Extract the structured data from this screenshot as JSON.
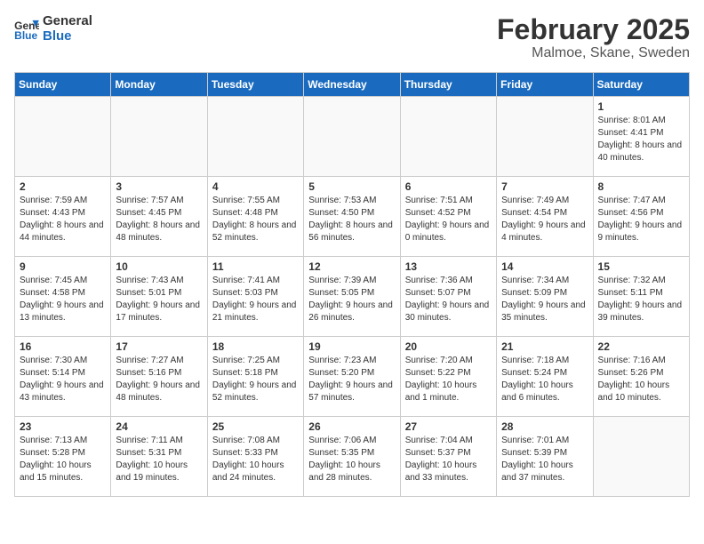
{
  "logo": {
    "general": "General",
    "blue": "Blue"
  },
  "header": {
    "title": "February 2025",
    "subtitle": "Malmoe, Skane, Sweden"
  },
  "weekdays": [
    "Sunday",
    "Monday",
    "Tuesday",
    "Wednesday",
    "Thursday",
    "Friday",
    "Saturday"
  ],
  "weeks": [
    [
      {
        "day": "",
        "info": ""
      },
      {
        "day": "",
        "info": ""
      },
      {
        "day": "",
        "info": ""
      },
      {
        "day": "",
        "info": ""
      },
      {
        "day": "",
        "info": ""
      },
      {
        "day": "",
        "info": ""
      },
      {
        "day": "1",
        "info": "Sunrise: 8:01 AM\nSunset: 4:41 PM\nDaylight: 8 hours and 40 minutes."
      }
    ],
    [
      {
        "day": "2",
        "info": "Sunrise: 7:59 AM\nSunset: 4:43 PM\nDaylight: 8 hours and 44 minutes."
      },
      {
        "day": "3",
        "info": "Sunrise: 7:57 AM\nSunset: 4:45 PM\nDaylight: 8 hours and 48 minutes."
      },
      {
        "day": "4",
        "info": "Sunrise: 7:55 AM\nSunset: 4:48 PM\nDaylight: 8 hours and 52 minutes."
      },
      {
        "day": "5",
        "info": "Sunrise: 7:53 AM\nSunset: 4:50 PM\nDaylight: 8 hours and 56 minutes."
      },
      {
        "day": "6",
        "info": "Sunrise: 7:51 AM\nSunset: 4:52 PM\nDaylight: 9 hours and 0 minutes."
      },
      {
        "day": "7",
        "info": "Sunrise: 7:49 AM\nSunset: 4:54 PM\nDaylight: 9 hours and 4 minutes."
      },
      {
        "day": "8",
        "info": "Sunrise: 7:47 AM\nSunset: 4:56 PM\nDaylight: 9 hours and 9 minutes."
      }
    ],
    [
      {
        "day": "9",
        "info": "Sunrise: 7:45 AM\nSunset: 4:58 PM\nDaylight: 9 hours and 13 minutes."
      },
      {
        "day": "10",
        "info": "Sunrise: 7:43 AM\nSunset: 5:01 PM\nDaylight: 9 hours and 17 minutes."
      },
      {
        "day": "11",
        "info": "Sunrise: 7:41 AM\nSunset: 5:03 PM\nDaylight: 9 hours and 21 minutes."
      },
      {
        "day": "12",
        "info": "Sunrise: 7:39 AM\nSunset: 5:05 PM\nDaylight: 9 hours and 26 minutes."
      },
      {
        "day": "13",
        "info": "Sunrise: 7:36 AM\nSunset: 5:07 PM\nDaylight: 9 hours and 30 minutes."
      },
      {
        "day": "14",
        "info": "Sunrise: 7:34 AM\nSunset: 5:09 PM\nDaylight: 9 hours and 35 minutes."
      },
      {
        "day": "15",
        "info": "Sunrise: 7:32 AM\nSunset: 5:11 PM\nDaylight: 9 hours and 39 minutes."
      }
    ],
    [
      {
        "day": "16",
        "info": "Sunrise: 7:30 AM\nSunset: 5:14 PM\nDaylight: 9 hours and 43 minutes."
      },
      {
        "day": "17",
        "info": "Sunrise: 7:27 AM\nSunset: 5:16 PM\nDaylight: 9 hours and 48 minutes."
      },
      {
        "day": "18",
        "info": "Sunrise: 7:25 AM\nSunset: 5:18 PM\nDaylight: 9 hours and 52 minutes."
      },
      {
        "day": "19",
        "info": "Sunrise: 7:23 AM\nSunset: 5:20 PM\nDaylight: 9 hours and 57 minutes."
      },
      {
        "day": "20",
        "info": "Sunrise: 7:20 AM\nSunset: 5:22 PM\nDaylight: 10 hours and 1 minute."
      },
      {
        "day": "21",
        "info": "Sunrise: 7:18 AM\nSunset: 5:24 PM\nDaylight: 10 hours and 6 minutes."
      },
      {
        "day": "22",
        "info": "Sunrise: 7:16 AM\nSunset: 5:26 PM\nDaylight: 10 hours and 10 minutes."
      }
    ],
    [
      {
        "day": "23",
        "info": "Sunrise: 7:13 AM\nSunset: 5:28 PM\nDaylight: 10 hours and 15 minutes."
      },
      {
        "day": "24",
        "info": "Sunrise: 7:11 AM\nSunset: 5:31 PM\nDaylight: 10 hours and 19 minutes."
      },
      {
        "day": "25",
        "info": "Sunrise: 7:08 AM\nSunset: 5:33 PM\nDaylight: 10 hours and 24 minutes."
      },
      {
        "day": "26",
        "info": "Sunrise: 7:06 AM\nSunset: 5:35 PM\nDaylight: 10 hours and 28 minutes."
      },
      {
        "day": "27",
        "info": "Sunrise: 7:04 AM\nSunset: 5:37 PM\nDaylight: 10 hours and 33 minutes."
      },
      {
        "day": "28",
        "info": "Sunrise: 7:01 AM\nSunset: 5:39 PM\nDaylight: 10 hours and 37 minutes."
      },
      {
        "day": "",
        "info": ""
      }
    ]
  ]
}
